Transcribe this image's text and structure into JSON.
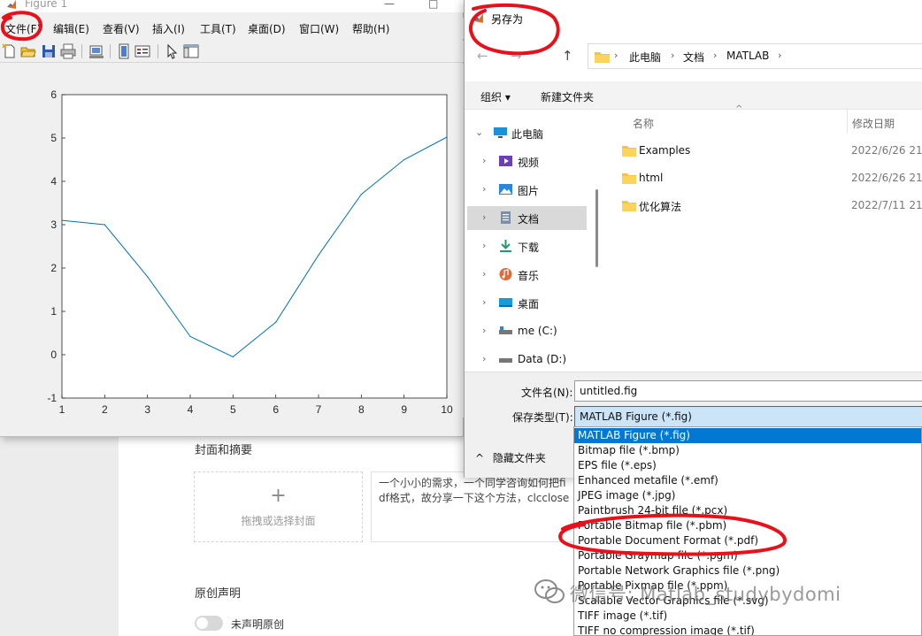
{
  "background": {
    "cover_section_title": "封面和摘要",
    "cover_upload_plus": "+",
    "cover_upload_label": "拖拽或选择封面",
    "summary_line1": "一个小小的需求，一个同学咨询如何把fi",
    "summary_line2": "df格式，故分享一下这个方法，clcclose",
    "original_section_title": "原创声明",
    "original_toggle_label": "未声明原创"
  },
  "figure": {
    "title": "Figure 1",
    "window_buttons": [
      "—",
      "□"
    ],
    "menu": [
      "文件(F)",
      "编辑(E)",
      "查看(V)",
      "插入(I)",
      "工具(T)",
      "桌面(D)",
      "窗口(W)",
      "帮助(H)"
    ],
    "toolbar_icons": [
      "new-figure-icon",
      "open-file-icon",
      "save-icon",
      "print-icon",
      "link-plot-icon",
      "insert-colorbar-icon",
      "insert-legend-icon",
      "pointer-icon",
      "property-inspector-icon"
    ]
  },
  "chart_data": {
    "type": "line",
    "x": [
      1,
      2,
      3,
      4,
      5,
      6,
      7,
      8,
      9,
      10
    ],
    "series": [
      {
        "values": [
          3.1,
          3.0,
          1.8,
          0.42,
          -0.05,
          0.75,
          2.3,
          3.7,
          4.5,
          5.02
        ],
        "color": "#0072bd"
      }
    ],
    "xlim": [
      1,
      10
    ],
    "ylim": [
      -1,
      6
    ],
    "xticks": [
      "1",
      "2",
      "3",
      "4",
      "5",
      "6",
      "7",
      "8",
      "9",
      "10"
    ],
    "yticks": [
      "-1",
      "0",
      "1",
      "2",
      "3",
      "4",
      "5",
      "6"
    ],
    "title": "",
    "xlabel": "",
    "ylabel": "",
    "grid": false
  },
  "dialog": {
    "title": "另存为",
    "nav_back": "←",
    "nav_forward": "→",
    "nav_up": "↑",
    "breadcrumb": [
      "此电脑",
      "文档",
      "MATLAB"
    ],
    "breadcrumb_separator": "›",
    "organize_label": "组织 ▾",
    "new_folder_label": "新建文件夹",
    "nav_tree": [
      {
        "label": "此电脑",
        "icon": "computer-icon",
        "expanded": true
      },
      {
        "label": "视频",
        "icon": "video-folder-icon"
      },
      {
        "label": "图片",
        "icon": "pictures-folder-icon"
      },
      {
        "label": "文档",
        "icon": "documents-folder-icon",
        "selected": true
      },
      {
        "label": "下载",
        "icon": "download-folder-icon"
      },
      {
        "label": "音乐",
        "icon": "music-folder-icon"
      },
      {
        "label": "桌面",
        "icon": "desktop-folder-icon"
      },
      {
        "label": "me (C:)",
        "icon": "drive-icon"
      },
      {
        "label": "Data (D:)",
        "icon": "drive-icon"
      }
    ],
    "columns": {
      "name": "名称",
      "modified": "修改日期",
      "sort_caret": "^"
    },
    "files": [
      {
        "name": "Examples",
        "modified": "2022/6/26 21:"
      },
      {
        "name": "html",
        "modified": "2022/6/26 21:"
      },
      {
        "name": "优化算法",
        "modified": "2022/7/11 21:"
      }
    ],
    "filename_label": "文件名(N):",
    "filename_value": "untitled.fig",
    "filetype_label": "保存类型(T):",
    "filetype_value": "MATLAB Figure (*.fig)",
    "hide_folders_label": "隐藏文件夹",
    "hide_folders_caret": "^",
    "filetype_options": [
      "MATLAB Figure (*.fig)",
      "Bitmap file (*.bmp)",
      "EPS file (*.eps)",
      "Enhanced metafile (*.emf)",
      "JPEG image (*.jpg)",
      "Paintbrush 24-bit file (*.pcx)",
      "Portable Bitmap file (*.pbm)",
      "Portable Document Format (*.pdf)",
      "Portable Graymap file (*.pgm)",
      "Portable Network Graphics file (*.png)",
      "Portable Pixmap file (*.ppm)",
      "Scalable Vector Graphics file (*.svg)",
      "TIFF image (*.tif)",
      "TIFF no compression image (*.tif)"
    ],
    "selected_option_index": 0
  },
  "watermark": {
    "text": "微信号: Matlab_studybydomi"
  },
  "colors": {
    "annotation": "#e8101a",
    "plot_line": "#0072bd",
    "selection": "#0078d4"
  }
}
